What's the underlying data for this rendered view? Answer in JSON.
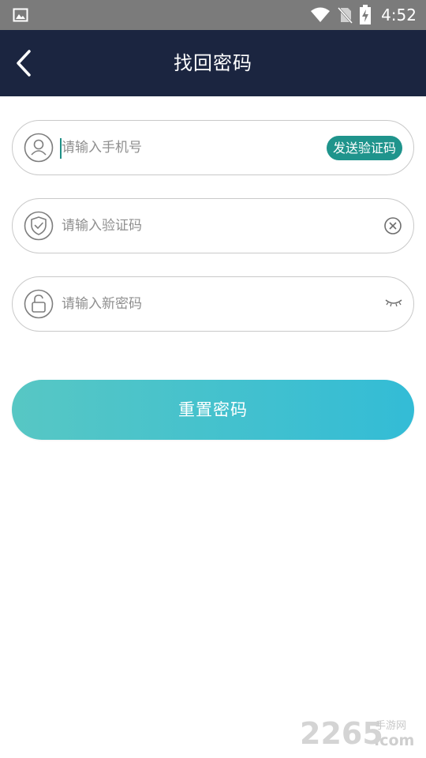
{
  "status_bar": {
    "time": "4:52",
    "icons": [
      "image-icon",
      "wifi-icon",
      "no-sim-icon",
      "battery-charging-icon"
    ]
  },
  "header": {
    "title": "找回密码",
    "back_icon": "chevron-left-icon"
  },
  "form": {
    "phone": {
      "placeholder": "请输入手机号",
      "icon": "user-icon"
    },
    "send_code_label": "发送验证码",
    "code": {
      "placeholder": "请输入验证码",
      "icon": "shield-check-icon",
      "action_icon": "clear-circle-icon"
    },
    "password": {
      "placeholder": "请输入新密码",
      "icon": "lock-icon",
      "action_icon": "eye-closed-icon"
    },
    "submit_label": "重置密码"
  },
  "watermark": {
    "brand": "2265",
    "suffix": ".com",
    "tag": "手游网"
  },
  "colors": {
    "header_bg": "#1b2540",
    "status_bg": "#7b7b7b",
    "accent": "#1f948c",
    "button_gradient_start": "#57c7c4",
    "button_gradient_end": "#33bcd6"
  }
}
